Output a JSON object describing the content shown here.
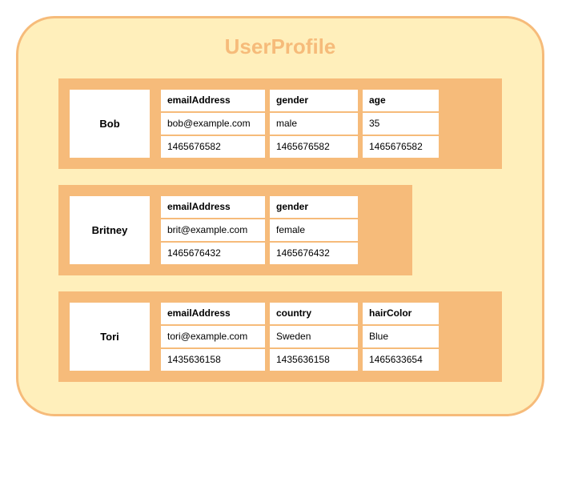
{
  "title": "UserProfile",
  "users": [
    {
      "name": "Bob",
      "attrs": [
        {
          "key": "emailAddress",
          "value": "bob@example.com",
          "ts": "1465676582"
        },
        {
          "key": "gender",
          "value": "male",
          "ts": "1465676582"
        },
        {
          "key": "age",
          "value": "35",
          "ts": "1465676582"
        }
      ]
    },
    {
      "name": "Britney",
      "attrs": [
        {
          "key": "emailAddress",
          "value": "brit@example.com",
          "ts": "1465676432"
        },
        {
          "key": "gender",
          "value": "female",
          "ts": "1465676432"
        }
      ]
    },
    {
      "name": "Tori",
      "attrs": [
        {
          "key": "emailAddress",
          "value": "tori@example.com",
          "ts": "1435636158"
        },
        {
          "key": "country",
          "value": "Sweden",
          "ts": "1435636158"
        },
        {
          "key": "hairColor",
          "value": "Blue",
          "ts": "1465633654"
        }
      ]
    }
  ]
}
